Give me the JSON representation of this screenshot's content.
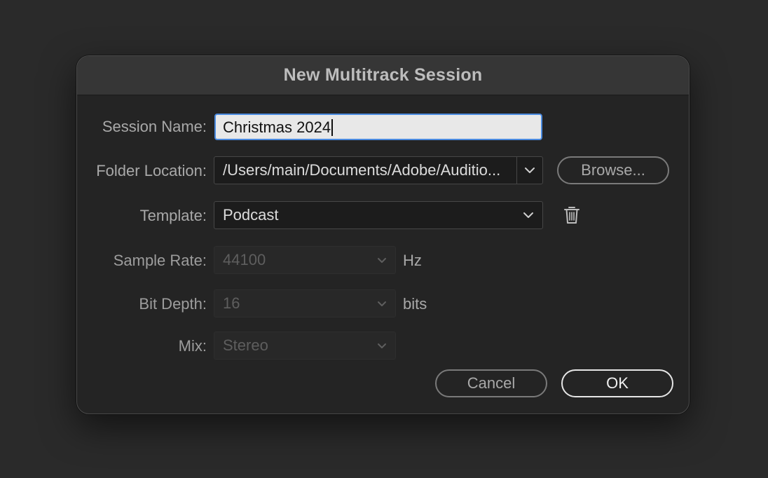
{
  "dialog": {
    "title": "New Multitrack Session"
  },
  "form": {
    "session_name": {
      "label": "Session Name:",
      "value": "Christmas 2024"
    },
    "folder_location": {
      "label": "Folder Location:",
      "value": "/Users/main/Documents/Adobe/Auditio..."
    },
    "template": {
      "label": "Template:",
      "value": "Podcast"
    },
    "sample_rate": {
      "label": "Sample Rate:",
      "value": "44100",
      "unit": "Hz"
    },
    "bit_depth": {
      "label": "Bit Depth:",
      "value": "16",
      "unit": "bits"
    },
    "mix": {
      "label": "Mix:",
      "value": "Stereo"
    }
  },
  "buttons": {
    "browse": "Browse...",
    "cancel": "Cancel",
    "ok": "OK"
  },
  "icons": {
    "dropdown": "chevron-down-icon",
    "delete_template": "trash-icon"
  },
  "colors": {
    "focus_ring": "#4b8be0",
    "dialog_bg": "#242424",
    "titlebar_bg": "#363636"
  }
}
